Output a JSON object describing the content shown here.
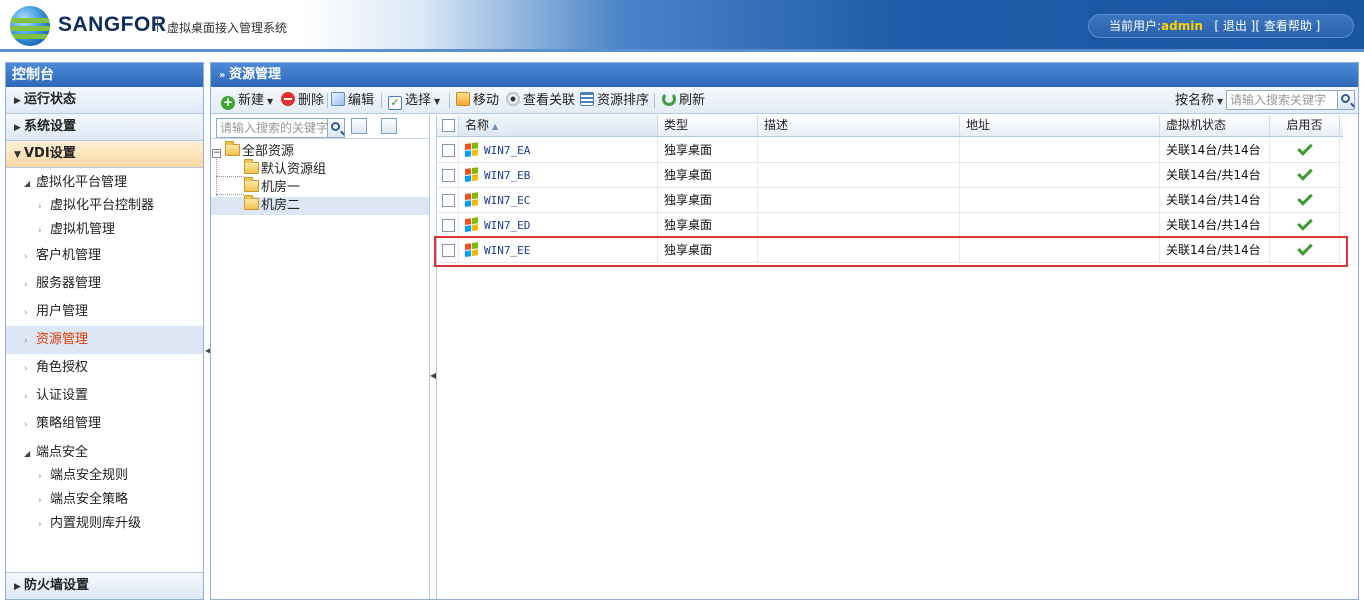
{
  "header": {
    "brand": "SANGFOR",
    "subtitle": "虚拟桌面接入管理系统",
    "current_user_label": "当前用户:",
    "current_user": "admin",
    "logout": "[ 退出 ]",
    "help": "[ 查看帮助 ]"
  },
  "sidebar": {
    "title": "控制台",
    "sections": [
      {
        "label": "运行状态"
      },
      {
        "label": "系统设置"
      },
      {
        "label": "VDI设置"
      }
    ],
    "vdi_items": {
      "platform": "虚拟化平台管理",
      "platform_controller": "虚拟化平台控制器",
      "vm_manage": "虚拟机管理",
      "client": "客户机管理",
      "server": "服务器管理",
      "user": "用户管理",
      "resource": "资源管理",
      "role": "角色授权",
      "auth": "认证设置",
      "policy_group": "策略组管理",
      "endpoint": "端点安全",
      "endpoint_rule": "端点安全规则",
      "endpoint_policy": "端点安全策略",
      "builtin_rule": "内置规则库升级"
    },
    "firewall": "防火墙设置"
  },
  "main": {
    "title": "资源管理",
    "toolbar": {
      "new": "新建",
      "delete": "删除",
      "edit": "编辑",
      "select": "选择",
      "move": "移动",
      "view_assoc": "查看关联",
      "sort": "资源排序",
      "refresh": "刷新",
      "search_by": "按名称",
      "search_placeholder": "请输入搜索关键字"
    },
    "tree": {
      "search_placeholder": "请输入搜索的关键字",
      "root": "全部资源",
      "children": [
        "默认资源组",
        "机房一",
        "机房二"
      ]
    },
    "grid": {
      "columns": [
        "名称",
        "类型",
        "描述",
        "地址",
        "虚拟机状态",
        "启用否"
      ],
      "rows": [
        {
          "name": "WIN7_EA",
          "type": "独享桌面",
          "desc": "",
          "addr": "",
          "vm_status": "关联14台/共14台",
          "enabled": true
        },
        {
          "name": "WIN7_EB",
          "type": "独享桌面",
          "desc": "",
          "addr": "",
          "vm_status": "关联14台/共14台",
          "enabled": true
        },
        {
          "name": "WIN7_EC",
          "type": "独享桌面",
          "desc": "",
          "addr": "",
          "vm_status": "关联14台/共14台",
          "enabled": true
        },
        {
          "name": "WIN7_ED",
          "type": "独享桌面",
          "desc": "",
          "addr": "",
          "vm_status": "关联14台/共14台",
          "enabled": true
        },
        {
          "name": "WIN7_EE",
          "type": "独享桌面",
          "desc": "",
          "addr": "",
          "vm_status": "关联14台/共14台",
          "enabled": true
        }
      ]
    }
  },
  "colors": {
    "accent": "#2d69b8",
    "selected_text": "#e03c00",
    "highlight_border": "#e03434",
    "enabled_check": "#3c9a32"
  }
}
